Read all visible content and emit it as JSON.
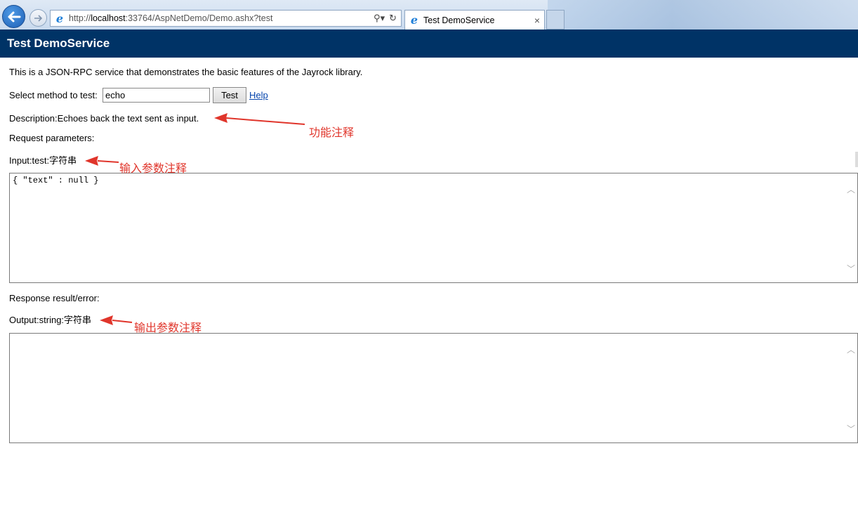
{
  "browser": {
    "url_prefix": "http://",
    "url_host": "localhost",
    "url_rest": ":33764/AspNetDemo/Demo.ashx?test",
    "tab_title": "Test DemoService",
    "tab_close": "×"
  },
  "page": {
    "header_title": "Test DemoService",
    "intro": "This is a JSON-RPC service that demonstrates the basic features of the Jayrock library.",
    "select_label": "Select method to test:",
    "method_value": "echo",
    "test_button": "Test",
    "help_link": "Help",
    "description": "Description:Echoes back the text sent as input.",
    "request_label": "Request parameters:",
    "input_label": "Input:test:字符串",
    "request_body": "{ \"text\" : null }",
    "response_label": "Response result/error:",
    "output_label": "Output:string:字符串",
    "response_body": ""
  },
  "annotations": {
    "function_note": "功能注释",
    "input_note": "输入参数注释",
    "output_note": "输出参数注释",
    "color": "#e0352b"
  },
  "icons": [
    "back-arrow-icon",
    "forward-arrow-icon",
    "ie-logo-icon",
    "search-icon",
    "refresh-icon",
    "close-icon",
    "scroll-up-icon",
    "scroll-down-icon"
  ]
}
